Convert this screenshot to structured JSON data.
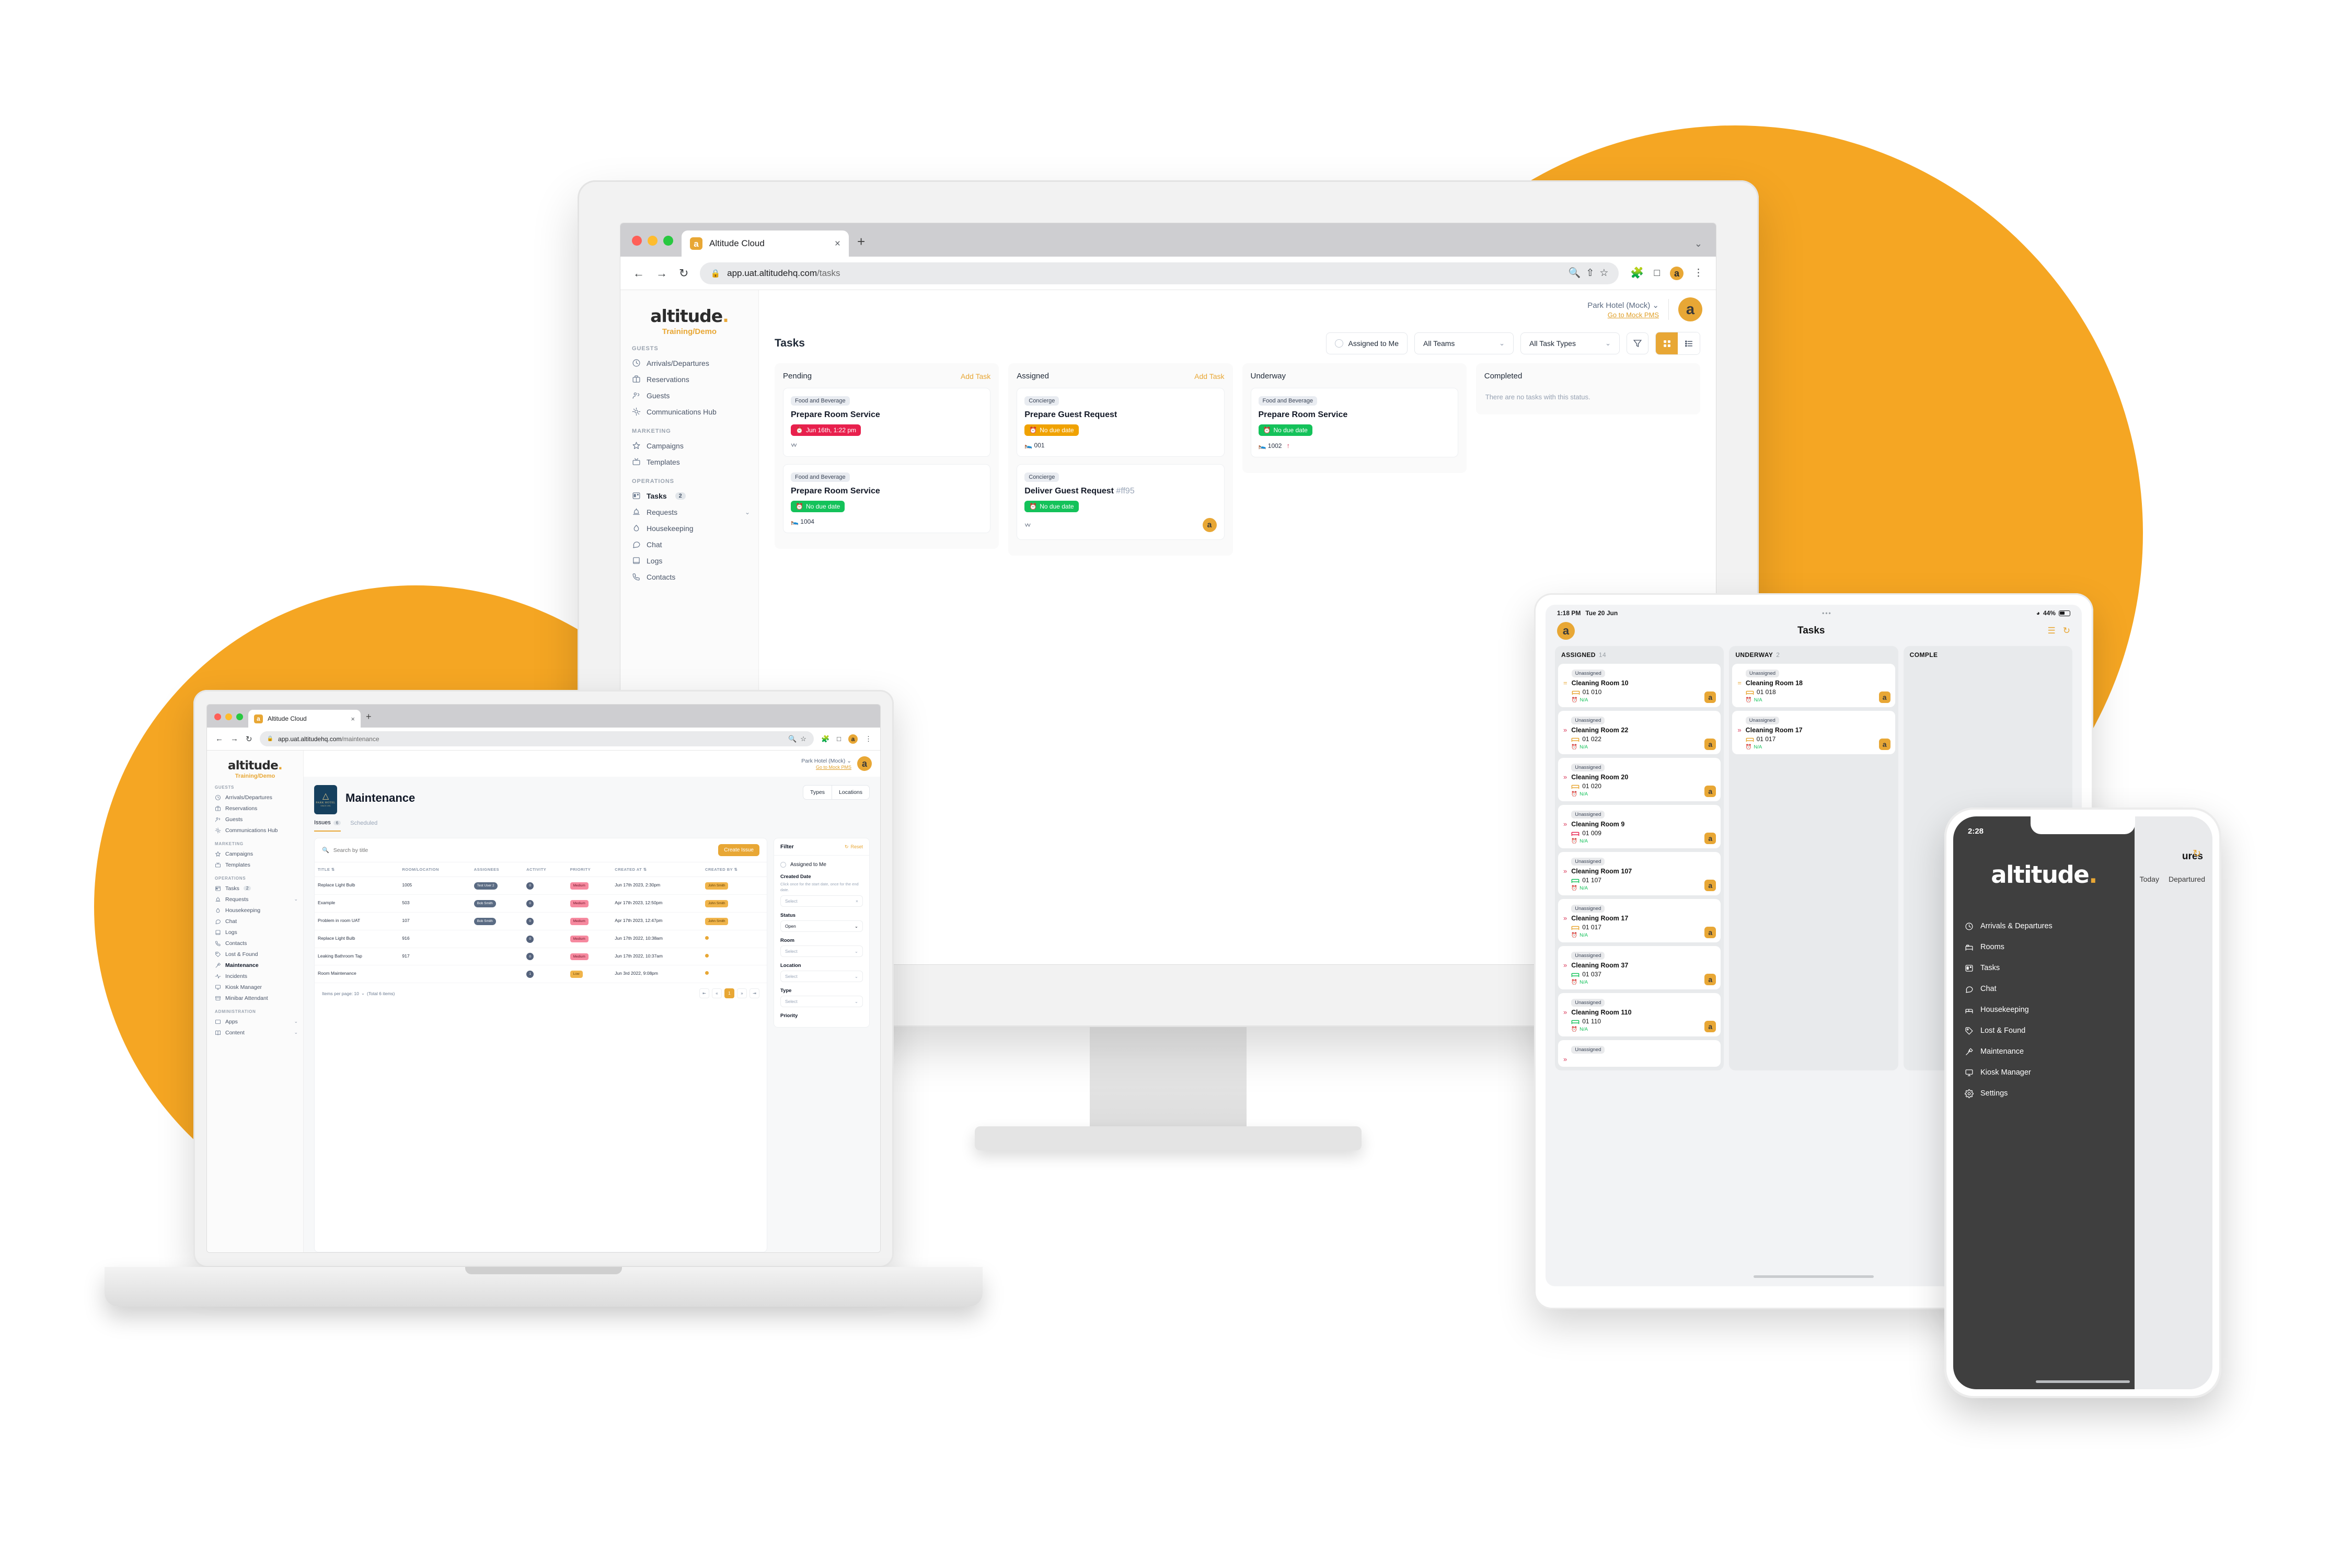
{
  "brand": {
    "name": "altitude",
    "accent_color": "#E8A735",
    "env_label": "Training/Demo"
  },
  "monitor": {
    "browser": {
      "tab_title": "Altitude Cloud",
      "tab_favicon": "altitude-a-icon",
      "new_tab": "+",
      "close_tab": "×",
      "back": "←",
      "forward": "→",
      "reload": "↻",
      "lock_icon": "lock-icon",
      "url_host": "app.uat.altitudehq.com",
      "url_path": "/tasks",
      "zoom_icon": "zoom-out-icon",
      "share_icon": "share-icon",
      "bookmark_icon": "star-icon",
      "extensions_icon": "puzzle-icon",
      "split_icon": "square-icon",
      "profile_icon": "a",
      "menu_icon": "⋮",
      "window_caret": "⌄"
    },
    "sidebar": {
      "groups": [
        {
          "label": "GUESTS",
          "items": [
            {
              "label": "Arrivals/Departures",
              "icon": "clock-icon"
            },
            {
              "label": "Reservations",
              "icon": "briefcase-icon"
            },
            {
              "label": "Guests",
              "icon": "users-icon"
            },
            {
              "label": "Communications Hub",
              "icon": "sun-icon"
            }
          ]
        },
        {
          "label": "MARKETING",
          "items": [
            {
              "label": "Campaigns",
              "icon": "star-icon"
            },
            {
              "label": "Templates",
              "icon": "tv-icon"
            }
          ]
        },
        {
          "label": "OPERATIONS",
          "items": [
            {
              "label": "Tasks",
              "icon": "board-icon",
              "badge": "2",
              "active": true
            },
            {
              "label": "Requests",
              "icon": "alarm-icon",
              "caret": "⌄"
            },
            {
              "label": "Housekeeping",
              "icon": "drop-icon"
            },
            {
              "label": "Chat",
              "icon": "chat-icon"
            },
            {
              "label": "Logs",
              "icon": "book-icon"
            },
            {
              "label": "Contacts",
              "icon": "phone-icon"
            }
          ]
        }
      ]
    },
    "topbar": {
      "hotel": "Park Hotel (Mock)",
      "hotel_caret": "⌄",
      "pms_link": "Go to Mock PMS",
      "avatar": "a"
    },
    "page_title": "Tasks",
    "toolbar": {
      "assigned_to_me": "Assigned to Me",
      "teams_filter": "All Teams",
      "task_types_filter": "All Task Types",
      "caret": "⌄",
      "filter_icon": "funnel-icon",
      "board_view_icon": "grid-icon",
      "list_view_icon": "list-icon"
    },
    "board": {
      "add_task": "Add Task",
      "columns": [
        {
          "title": "Pending",
          "has_add": true,
          "cards": [
            {
              "tag": "Food and Beverage",
              "title": "Prepare Room Service",
              "due": "Jun 16th, 1:22 pm",
              "due_state": "red",
              "room": "",
              "expand": true
            },
            {
              "tag": "Food and Beverage",
              "title": "Prepare Room Service",
              "due": "No due date",
              "due_state": "green",
              "room": "1004"
            }
          ]
        },
        {
          "title": "Assigned",
          "has_add": true,
          "cards": [
            {
              "tag": "Concierge",
              "title": "Prepare Guest Request",
              "due": "No due date",
              "due_state": "amber",
              "room": "001"
            },
            {
              "tag": "Concierge",
              "title": "Deliver Guest Request",
              "hash": "#ff95",
              "due": "No due date",
              "due_state": "green",
              "room": "",
              "expand": true,
              "avatar": "a"
            }
          ]
        },
        {
          "title": "Underway",
          "has_add": false,
          "cards": [
            {
              "tag": "Food and Beverage",
              "title": "Prepare Room Service",
              "due": "No due date",
              "due_state": "green",
              "room": "1002",
              "priority_high": true
            }
          ]
        },
        {
          "title": "Completed",
          "has_add": false,
          "empty_text": "There are no tasks with this status.",
          "cards": []
        }
      ]
    }
  },
  "laptop": {
    "browser": {
      "tab_title": "Altitude Cloud",
      "url_host": "app.uat.altitudehq.com",
      "url_path": "/maintenance",
      "back": "←",
      "forward": "→",
      "reload": "↻",
      "search_icon": "zoom-out-icon",
      "bookmark_icon": "star-icon",
      "extensions_icon": "puzzle-icon",
      "split_icon": "square-icon",
      "profile_icon": "a",
      "menu_icon": "⋮",
      "new_tab": "+",
      "close_tab": "×"
    },
    "sidebar": {
      "groups": [
        {
          "label": "GUESTS",
          "items": [
            {
              "label": "Arrivals/Departures",
              "icon": "clock-icon"
            },
            {
              "label": "Reservations",
              "icon": "briefcase-icon"
            },
            {
              "label": "Guests",
              "icon": "users-icon"
            },
            {
              "label": "Communications Hub",
              "icon": "sun-icon"
            }
          ]
        },
        {
          "label": "MARKETING",
          "items": [
            {
              "label": "Campaigns",
              "icon": "star-icon"
            },
            {
              "label": "Templates",
              "icon": "tv-icon"
            }
          ]
        },
        {
          "label": "OPERATIONS",
          "items": [
            {
              "label": "Tasks",
              "icon": "board-icon",
              "badge": "2"
            },
            {
              "label": "Requests",
              "icon": "alarm-icon",
              "caret": "⌄"
            },
            {
              "label": "Housekeeping",
              "icon": "drop-icon"
            },
            {
              "label": "Chat",
              "icon": "chat-icon"
            },
            {
              "label": "Logs",
              "icon": "book-icon"
            },
            {
              "label": "Contacts",
              "icon": "phone-icon"
            },
            {
              "label": "Lost & Found",
              "icon": "tag-icon"
            },
            {
              "label": "Maintenance",
              "icon": "hammer-icon",
              "active": true
            },
            {
              "label": "Incidents",
              "icon": "pulse-icon"
            },
            {
              "label": "Kiosk Manager",
              "icon": "monitor-icon"
            },
            {
              "label": "Minibar Attendant",
              "icon": "drawer-icon"
            }
          ]
        },
        {
          "label": "ADMINISTRATION",
          "items": [
            {
              "label": "Apps",
              "icon": "window-icon",
              "caret": "⌄"
            },
            {
              "label": "Content",
              "icon": "book-open-icon",
              "caret": "⌄"
            }
          ]
        }
      ]
    },
    "topbar": {
      "hotel": "Park Hotel (Mock)",
      "pms_link": "Go to Mock PMS",
      "avatar": "a"
    },
    "hotel_logo": {
      "name": "PARK HOTEL",
      "since": "SINCE 1991",
      "icon": "tree-icon"
    },
    "page_title": "Maintenance",
    "header_buttons": [
      "Types",
      "Locations"
    ],
    "tabs": [
      {
        "label": "Issues",
        "count": "6",
        "active": true
      },
      {
        "label": "Scheduled",
        "active": false
      }
    ],
    "search_placeholder": "Search by title",
    "create_button": "Create Issue",
    "table": {
      "columns": [
        "TITLE",
        "ROOM/LOCATION",
        "ASSIGNEES",
        "ACTIVITY",
        "PRIORITY",
        "CREATED AT",
        "CREATED BY"
      ],
      "rows": [
        {
          "title": "Replace Light Bulb",
          "room": "1005",
          "assignee": "Test User 2",
          "activity": "0",
          "priority": "Medium",
          "priority_level": "med",
          "created_at": "Jun 17th 2023, 2:30pm",
          "created_by": "John Smith",
          "created_by_kind": "chip"
        },
        {
          "title": "Example",
          "room": "503",
          "assignee": "Bob Smith",
          "activity": "0",
          "priority": "Medium",
          "priority_level": "med",
          "created_at": "Apr 17th 2023, 12:50pm",
          "created_by": "John Smith",
          "created_by_kind": "chip"
        },
        {
          "title": "Problem in room UAT",
          "room": "107",
          "assignee": "Bob Smith",
          "activity": "0",
          "priority": "Medium",
          "priority_level": "med",
          "created_at": "Apr 17th 2023, 12:47pm",
          "created_by": "John Smith",
          "created_by_kind": "chip"
        },
        {
          "title": "Replace Light Bulb",
          "room": "916",
          "assignee": "",
          "activity": "0",
          "priority": "Medium",
          "priority_level": "med",
          "created_at": "Jun 17th 2022, 10:38am",
          "created_by": "",
          "created_by_kind": "dot"
        },
        {
          "title": "Leaking Bathroom Tap",
          "room": "917",
          "assignee": "",
          "activity": "0",
          "priority": "Medium",
          "priority_level": "med",
          "created_at": "Jun 17th 2022, 10:37am",
          "created_by": "",
          "created_by_kind": "dot"
        },
        {
          "title": "Room Maintenance",
          "room": "",
          "assignee": "",
          "activity": "1",
          "priority": "Low",
          "priority_level": "low",
          "created_at": "Jun 3rd 2022, 9:08pm",
          "created_by": "",
          "created_by_kind": "dot"
        }
      ]
    },
    "pagination": {
      "items_per_page_label": "Items per page: 10",
      "caret": "⌄",
      "total": "(Total 6 items)",
      "first": "⇤",
      "prev": "«",
      "current": "1",
      "next": "»",
      "last": "⇥"
    },
    "filter": {
      "title": "Filter",
      "reset": "Reset",
      "reset_icon": "refresh-icon",
      "assigned_to_me": "Assigned to Me",
      "created_date_label": "Created Date",
      "created_date_hint": "Click once for the start date, once for the end date.",
      "created_date_value": "Select",
      "clear_icon": "×",
      "status_label": "Status",
      "status_value": "Open",
      "room_label": "Room",
      "room_value": "Select",
      "location_label": "Location",
      "location_value": "Select",
      "type_label": "Type",
      "type_value": "Select",
      "priority_label": "Priority"
    }
  },
  "tablet": {
    "status": {
      "time": "1:18 PM",
      "date": "Tue 20 Jun",
      "dots": "•••",
      "wifi_icon": "wifi-icon",
      "battery": "44%"
    },
    "logo": "a",
    "title": "Tasks",
    "filter_icon": "filter-icon",
    "refresh_icon": "refresh-icon",
    "columns": [
      {
        "title": "ASSIGNED",
        "count": "14",
        "cards": [
          {
            "status": "Unassigned",
            "title": "Cleaning Room 10",
            "room": "01 010",
            "room_state": "amber",
            "due": "N/A",
            "priority": "mid",
            "avatar": "a"
          },
          {
            "status": "Unassigned",
            "title": "Cleaning Room 22",
            "room": "01 022",
            "room_state": "amber",
            "due": "N/A",
            "priority": "high",
            "avatar": "a"
          },
          {
            "status": "Unassigned",
            "title": "Cleaning Room 20",
            "room": "01 020",
            "room_state": "amber",
            "due": "N/A",
            "priority": "high",
            "avatar": "a"
          },
          {
            "status": "Unassigned",
            "title": "Cleaning Room 9",
            "room": "01 009",
            "room_state": "red",
            "due": "N/A",
            "priority": "high",
            "avatar": "a"
          },
          {
            "status": "Unassigned",
            "title": "Cleaning Room 107",
            "room": "01 107",
            "room_state": "green",
            "due": "N/A",
            "priority": "high",
            "avatar": "a"
          },
          {
            "status": "Unassigned",
            "title": "Cleaning Room 17",
            "room": "01 017",
            "room_state": "amber",
            "due": "N/A",
            "priority": "high",
            "avatar": "a"
          },
          {
            "status": "Unassigned",
            "title": "Cleaning Room 37",
            "room": "01 037",
            "room_state": "green",
            "due": "N/A",
            "priority": "high",
            "avatar": "a"
          },
          {
            "status": "Unassigned",
            "title": "Cleaning Room 110",
            "room": "01 110",
            "room_state": "green",
            "due": "N/A",
            "priority": "high",
            "avatar": "a"
          },
          {
            "status": "Unassigned",
            "title": "",
            "room": "",
            "room_state": "amber",
            "due": "",
            "priority": "high",
            "avatar": ""
          }
        ]
      },
      {
        "title": "UNDERWAY",
        "count": "2",
        "cards": [
          {
            "status": "Unassigned",
            "title": "Cleaning Room 18",
            "room": "01 018",
            "room_state": "amber",
            "due": "N/A",
            "priority": "mid",
            "avatar": "a"
          },
          {
            "status": "Unassigned",
            "title": "Cleaning Room 17",
            "room": "01 017",
            "room_state": "amber",
            "due": "N/A",
            "priority": "high",
            "avatar": "a"
          }
        ]
      },
      {
        "title": "COMPLE",
        "count": "",
        "cards": []
      }
    ]
  },
  "phone": {
    "time": "2:28",
    "background": {
      "title": "ures",
      "tabs": [
        "Today",
        "Departured"
      ],
      "refresh_icon": "refresh-icon"
    },
    "brand": "altitude",
    "menu": [
      {
        "label": "Arrivals & Departures",
        "icon": "clock-icon"
      },
      {
        "label": "Rooms",
        "icon": "bed-icon"
      },
      {
        "label": "Tasks",
        "icon": "board-icon"
      },
      {
        "label": "Chat",
        "icon": "chat-icon"
      },
      {
        "label": "Housekeeping",
        "icon": "bed-made-icon"
      },
      {
        "label": "Lost & Found",
        "icon": "tag-icon"
      },
      {
        "label": "Maintenance",
        "icon": "hammer-icon"
      },
      {
        "label": "Kiosk Manager",
        "icon": "monitor-icon"
      },
      {
        "label": "Settings",
        "icon": "gear-icon"
      }
    ]
  }
}
